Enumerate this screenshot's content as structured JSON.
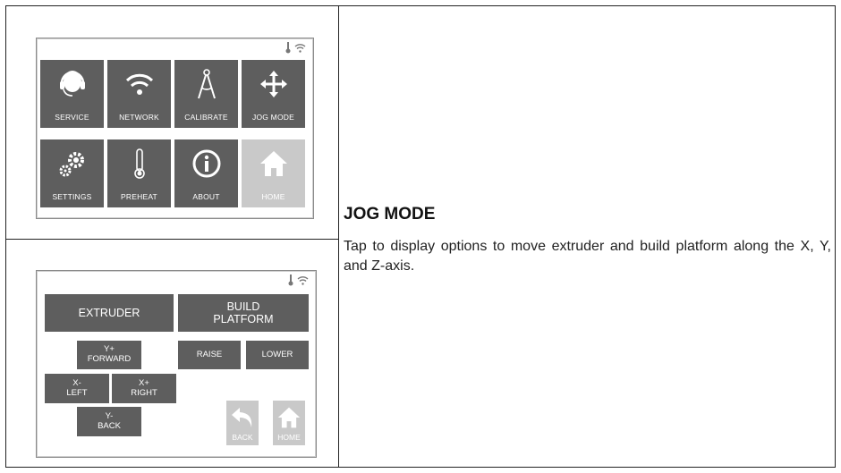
{
  "menu_screen": {
    "tiles": [
      {
        "label": "SERVICE",
        "icon": "headset-icon"
      },
      {
        "label": "NETWORK",
        "icon": "wifi-icon"
      },
      {
        "label": "CALIBRATE",
        "icon": "compass-icon"
      },
      {
        "label": "JOG MODE",
        "icon": "move-arrows-icon"
      },
      {
        "label": "SETTINGS",
        "icon": "gears-icon"
      },
      {
        "label": "PREHEAT",
        "icon": "thermometer-icon"
      },
      {
        "label": "ABOUT",
        "icon": "info-icon"
      },
      {
        "label": "HOME",
        "icon": "home-icon"
      }
    ]
  },
  "jog_screen": {
    "extruder": "EXTRUDER",
    "build_platform": "BUILD\nPLATFORM",
    "y_forward": "Y+\nFORWARD",
    "x_left": "X-\nLEFT",
    "x_right": "X+\nRIGHT",
    "y_back": "Y-\nBACK",
    "raise": "RAISE",
    "lower": "LOWER",
    "back": "BACK",
    "home": "HOME"
  },
  "description": {
    "heading": "JOG MODE",
    "body": "Tap to display options to move extruder and build platform along the X, Y, and Z-axis."
  },
  "colors": {
    "tile": "#5e5e5e",
    "tile_disabled": "#c9c9c9"
  }
}
